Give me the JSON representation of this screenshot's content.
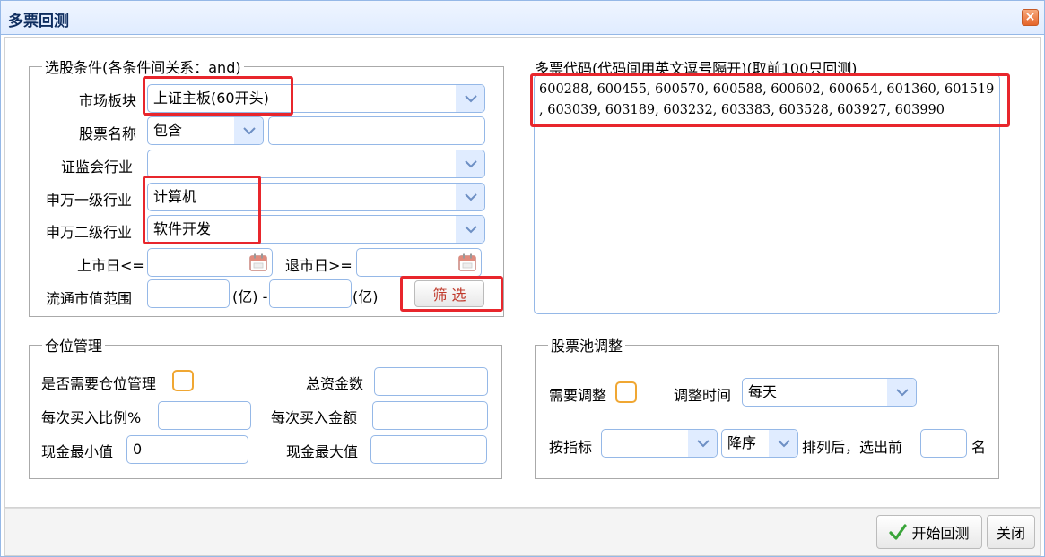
{
  "window": {
    "title": "多票回测",
    "close_label": "×"
  },
  "filter": {
    "legend": "选股条件(各条件间关系：and)",
    "market_label": "市场板块",
    "market_value": "上证主板(60开头)",
    "name_label": "股票名称",
    "name_mode": "包含",
    "name_value": "",
    "csrc_label": "证监会行业",
    "csrc_value": "",
    "sw1_label": "申万一级行业",
    "sw1_value": "计算机",
    "sw2_label": "申万二级行业",
    "sw2_value": "软件开发",
    "list_date_label": "上市日<=",
    "list_date_value": "",
    "delist_date_label": "退市日>=",
    "delist_date_value": "",
    "float_cap_label": "流通市值范围",
    "float_cap_min": "",
    "float_cap_unit1": "(亿) -",
    "float_cap_max": "",
    "float_cap_unit2": "(亿)",
    "filter_button": "筛 选"
  },
  "codes": {
    "label": "多票代码(代码间用英文逗号隔开)(取前100只回测)",
    "value": "600288, 600455, 600570, 600588, 600602, 600654, 601360, 601519\n, 603039, 603189, 603232, 603383, 603528, 603927, 603990"
  },
  "position": {
    "legend": "仓位管理",
    "need_label": "是否需要仓位管理",
    "need_checked": false,
    "total_label": "总资金数",
    "total_value": "",
    "ratio_label": "每次买入比例%",
    "ratio_value": "",
    "amount_label": "每次买入金额",
    "amount_value": "",
    "cash_min_label": "现金最小值",
    "cash_min_value": "0",
    "cash_max_label": "现金最大值",
    "cash_max_value": ""
  },
  "pool": {
    "legend": "股票池调整",
    "need_label": "需要调整",
    "need_checked": false,
    "time_label": "调整时间",
    "time_value": "每天",
    "indicator_label": "按指标",
    "indicator_value": "",
    "order_value": "降序",
    "rank_label": "排列后，选出前",
    "top_n_value": "",
    "unit_label": "名"
  },
  "footer": {
    "start_button": "开始回测",
    "close_button": "关闭"
  },
  "colors": {
    "highlight": "#e8262c",
    "field_border": "#95b8e7",
    "checkbox_border": "#f0a733",
    "filter_text": "#c0392b",
    "check_icon": "#3aa53a"
  }
}
